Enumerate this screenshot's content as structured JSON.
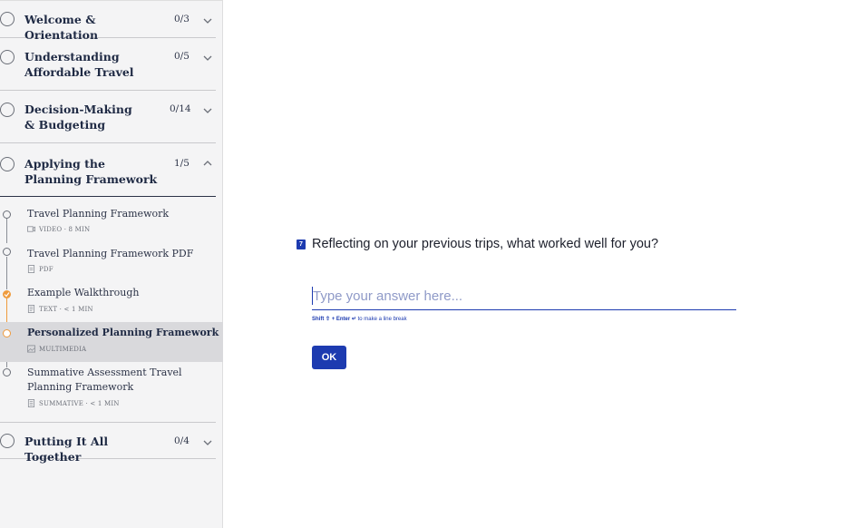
{
  "sidebar": {
    "sections": [
      {
        "title": "Welcome & Orientation",
        "count": "0/3",
        "chevron": "chevron-down-icon"
      },
      {
        "title": "Understanding Affordable Travel",
        "count": "0/5",
        "chevron": "chevron-down-icon"
      },
      {
        "title": "Decision-Making & Budgeting",
        "count": "0/14",
        "chevron": "chevron-down-icon"
      },
      {
        "title": "Applying the Planning Framework",
        "count": "1/5",
        "chevron": "chevron-up-icon"
      },
      {
        "title": "Putting It All Together",
        "count": "0/4",
        "chevron": "chevron-down-icon"
      }
    ],
    "lessons": [
      {
        "title": "Travel Planning Framework",
        "meta": "VIDEO · 8 MIN",
        "icon": "video-icon",
        "status": "not-started"
      },
      {
        "title": "Travel Planning Framework PDF",
        "meta": "PDF",
        "icon": "document-icon",
        "status": "not-started"
      },
      {
        "title": "Example Walkthrough",
        "meta": "TEXT · < 1 MIN",
        "icon": "text-icon",
        "status": "completed"
      },
      {
        "title": "Personalized Planning Framework",
        "meta": "MULTIMEDIA",
        "icon": "multimedia-icon",
        "status": "current"
      },
      {
        "title": "Summative Assessment Travel Planning Framework",
        "meta": "SUMMATIVE · < 1 MIN",
        "icon": "summative-icon",
        "status": "not-started"
      }
    ]
  },
  "main": {
    "question_number": "7",
    "question": "Reflecting on your previous trips, what worked well for you?",
    "answer_value": "",
    "answer_placeholder": "Type your answer here...",
    "hint": {
      "keys": "Shift ⇧ + Enter ↵",
      "text": " to make a line break"
    },
    "ok_label": "OK"
  },
  "colors": {
    "accent": "#1d3bb0",
    "progress": "#ef9b3d",
    "sidebar_bg": "#f4f4f5",
    "active_lesson_bg": "#d9d9dc"
  }
}
